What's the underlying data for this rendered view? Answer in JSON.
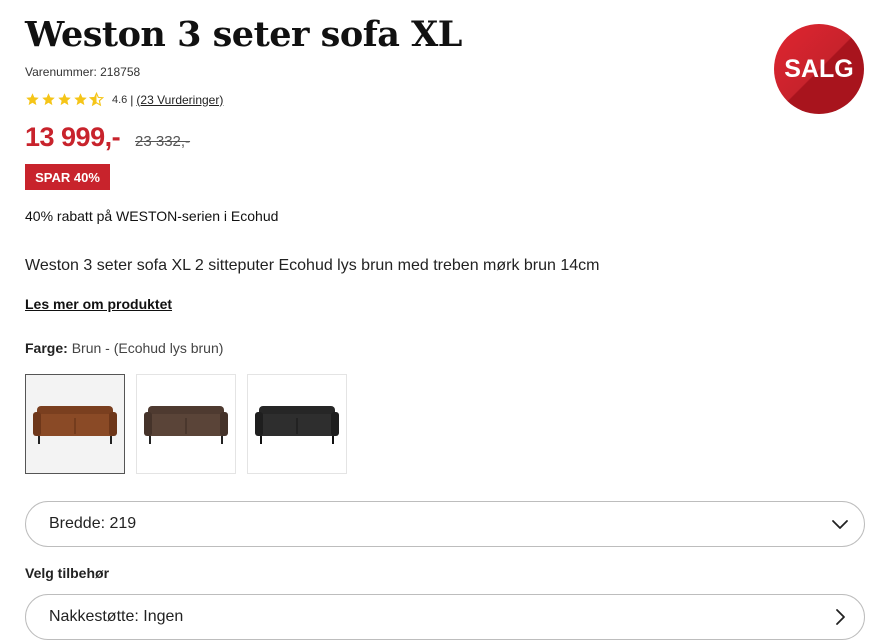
{
  "product": {
    "title": "Weston 3 seter sofa XL",
    "sku": "Varenummer: 218758",
    "rating_value": "4.6",
    "rating_separator": "|",
    "reviews_link": "(23 Vurderinger)",
    "price": "13 999,-",
    "old_price": "23 332,-",
    "save_badge": "SPAR 40%",
    "promo_text": "40% rabatt på WESTON-serien i Ecohud",
    "description": "Weston 3 seter sofa XL 2 sitteputer Ecohud lys brun med treben mørk brun 14cm",
    "read_more": "Les mer om produktet",
    "sale_badge": "SALG",
    "rating": {
      "stars": 4.6,
      "max": 5,
      "star_color": "#f5c518"
    }
  },
  "color": {
    "label": "Farge:",
    "value": "Brun - (Ecohud lys brun)",
    "swatches": [
      {
        "name": "lys brun",
        "color": "#8a4a26",
        "selected": true
      },
      {
        "name": "mørk brun",
        "color": "#5a4438",
        "selected": false
      },
      {
        "name": "sort",
        "color": "#2e2e2e",
        "selected": false
      }
    ]
  },
  "width_select": {
    "label": "Bredde: 219",
    "icon": "chevron-down-icon"
  },
  "accessories": {
    "label": "Velg tilbehør",
    "neck_support": "Nakkestøtte: Ingen",
    "icon": "chevron-right-icon"
  },
  "colors": {
    "accent": "#c8232c",
    "text": "#1a1a1a",
    "border": "#bdbdbd"
  }
}
